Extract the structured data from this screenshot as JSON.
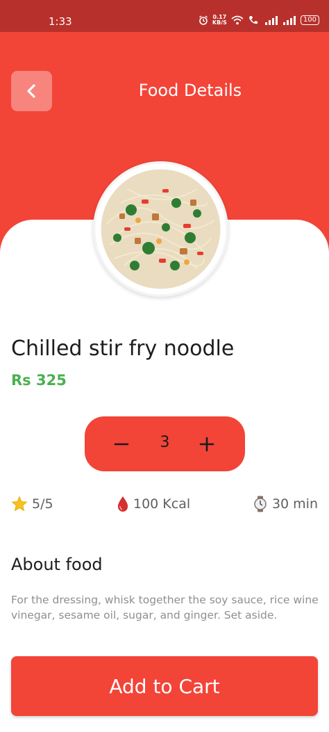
{
  "status_bar": {
    "time": "1:33",
    "net_speed_top": "0.17",
    "net_speed_bottom": "KB/S",
    "battery": "100"
  },
  "header": {
    "title": "Food Details"
  },
  "food": {
    "name": "Chilled stir fry noodle",
    "price": "Rs 325",
    "quantity": "3",
    "rating": "5/5",
    "calories": "100 Kcal",
    "time": "30 min"
  },
  "about": {
    "title": "About food",
    "text": "For the dressing, whisk together the soy sauce, rice wine vinegar, sesame oil, sugar, and ginger. Set aside."
  },
  "cart": {
    "label": "Add to Cart"
  },
  "colors": {
    "primary": "#f34438",
    "price_green": "#4caf50",
    "status_bar": "#b8302b"
  }
}
